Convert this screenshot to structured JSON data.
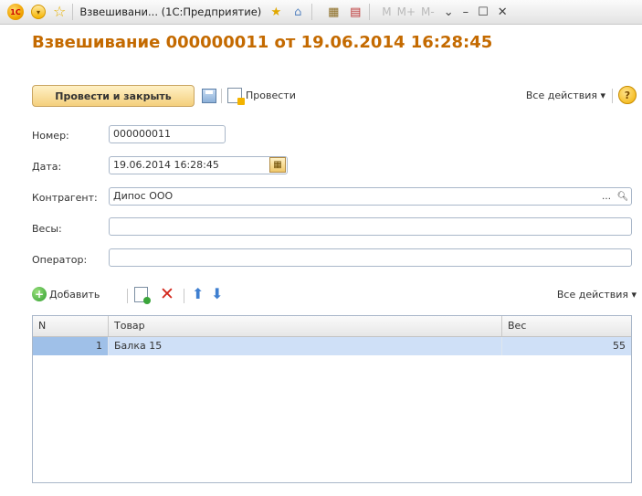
{
  "window": {
    "title": "Взвешивани... (1С:Предприятие)",
    "logo_text": "1С",
    "calc_labels": [
      "M",
      "M+",
      "M-"
    ]
  },
  "document": {
    "title": "Взвешивание 000000011 от 19.06.2014 16:28:45"
  },
  "toolbar": {
    "post_close_label": "Провести и закрыть",
    "post_label": "Провести",
    "all_actions_label": "Все действия ▾",
    "help_label": "?"
  },
  "form": {
    "number_label": "Номер:",
    "number_value": "000000011",
    "date_label": "Дата:",
    "date_value": "19.06.2014 16:28:45",
    "counterparty_label": "Контрагент:",
    "counterparty_value": "Дипос ООО",
    "scales_label": "Весы:",
    "scales_value": "",
    "operator_label": "Оператор:",
    "operator_value": ""
  },
  "list_toolbar": {
    "add_label": "Добавить",
    "all_actions_label": "Все действия ▾"
  },
  "table": {
    "columns": [
      "N",
      "Товар",
      "Вес"
    ],
    "rows": [
      {
        "n": "1",
        "product": "Балка 15",
        "weight": "55"
      }
    ]
  },
  "colors": {
    "title_orange": "#c46a00",
    "selected_row": "#cfe0f7",
    "primary_button": "#f4cf7c"
  }
}
